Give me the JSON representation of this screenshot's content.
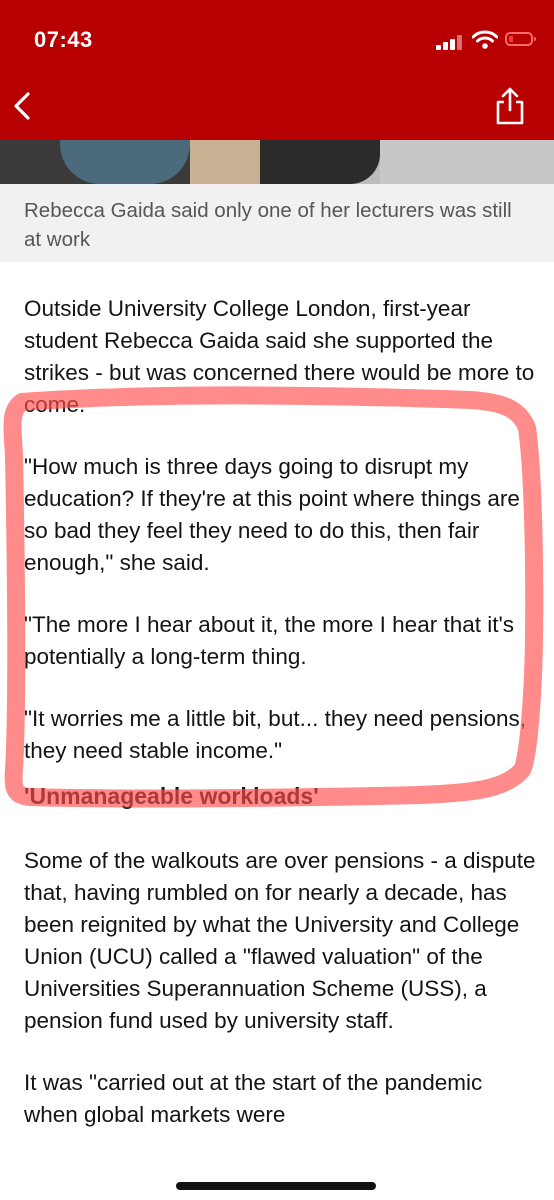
{
  "status_bar": {
    "time": "07:43",
    "signal_icon": "cellular-signal-icon",
    "wifi_icon": "wifi-icon",
    "battery_icon": "battery-low-icon",
    "battery_color": "#ff3b30"
  },
  "nav": {
    "back_icon": "chevron-left-icon",
    "share_icon": "share-icon",
    "bar_color": "#b80000"
  },
  "image": {
    "caption": "Rebecca Gaida said only one of her lecturers was still at work"
  },
  "article": {
    "p1": "Outside University College London, first-year student Rebecca Gaida said she supported the strikes - but was concerned there would be more to come.",
    "p2": "\"How much is three days going to disrupt my education? If they're at this point where things are so bad they feel they need to do this, then fair enough,\" she said.",
    "p3": "\"The more I hear about it, the more I hear that it's potentially a long-term thing.",
    "p4": "\"It worries me a little bit, but... they need pensions, they need stable income.\"",
    "heading": "'Unmanageable workloads'",
    "p5": "Some of the walkouts are over pensions - a dispute that, having rumbled on for nearly a decade, has been reignited by what the University and College Union (UCU) called a \"flawed valuation\" of the Universities Superannuation Scheme (USS), a pension fund used by university staff.",
    "p6": "It was \"carried out at the start of the pandemic when global markets were"
  },
  "annotation": {
    "color": "#ff4d4d"
  }
}
